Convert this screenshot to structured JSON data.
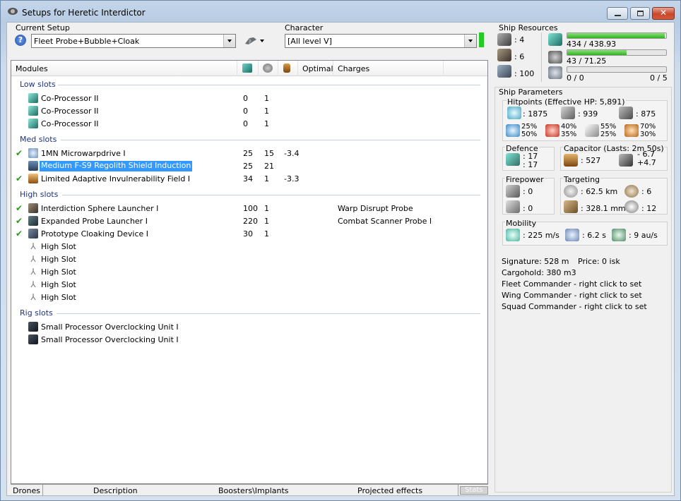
{
  "window": {
    "title": "Setups for Heretic Interdictor",
    "buttons": {
      "minimize": "minimize-icon",
      "maximize": "maximize-icon",
      "close": "close-icon"
    }
  },
  "setup": {
    "label": "Current Setup",
    "value": "Fleet Probe+Bubble+Cloak"
  },
  "character": {
    "label": "Character",
    "value": "[All level V]",
    "status_color": "#22cc22"
  },
  "columns": [
    "Modules",
    "",
    "",
    "",
    "Optimal",
    "Charges"
  ],
  "groups": {
    "low": "Low slots",
    "med": "Med slots",
    "high": "High slots",
    "rig": "Rig slots"
  },
  "modules": {
    "low": [
      {
        "name": "Co-Processor II",
        "cpu": "0",
        "pg": "1",
        "cap": "",
        "charge": ""
      },
      {
        "name": "Co-Processor II",
        "cpu": "0",
        "pg": "1",
        "cap": "",
        "charge": ""
      },
      {
        "name": "Co-Processor II",
        "cpu": "0",
        "pg": "1",
        "cap": "",
        "charge": ""
      }
    ],
    "med": [
      {
        "name": "1MN Microwarpdrive I",
        "cpu": "25",
        "pg": "15",
        "cap": "-3.4",
        "charge": ""
      },
      {
        "name": "Medium F-S9 Regolith Shield Induction",
        "cpu": "25",
        "pg": "21",
        "cap": "",
        "charge": ""
      },
      {
        "name": "Limited Adaptive Invulnerability Field I",
        "cpu": "34",
        "pg": "1",
        "cap": "-3.3",
        "charge": ""
      }
    ],
    "high": [
      {
        "name": "Interdiction Sphere Launcher I",
        "cpu": "100",
        "pg": "1",
        "cap": "",
        "charge": "Warp Disrupt Probe"
      },
      {
        "name": "Expanded Probe Launcher I",
        "cpu": "220",
        "pg": "1",
        "cap": "",
        "charge": "Combat Scanner Probe I"
      },
      {
        "name": "Prototype Cloaking Device I",
        "cpu": "30",
        "pg": "1",
        "cap": "",
        "charge": ""
      },
      {
        "name": "High Slot",
        "cpu": "",
        "pg": "",
        "cap": "",
        "charge": ""
      },
      {
        "name": "High Slot",
        "cpu": "",
        "pg": "",
        "cap": "",
        "charge": ""
      },
      {
        "name": "High Slot",
        "cpu": "",
        "pg": "",
        "cap": "",
        "charge": ""
      },
      {
        "name": "High Slot",
        "cpu": "",
        "pg": "",
        "cap": "",
        "charge": ""
      },
      {
        "name": "High Slot",
        "cpu": "",
        "pg": "",
        "cap": "",
        "charge": ""
      }
    ],
    "rig": [
      {
        "name": "Small Processor Overclocking Unit I",
        "cpu": "",
        "pg": "",
        "cap": "",
        "charge": ""
      },
      {
        "name": "Small Processor Overclocking Unit I",
        "cpu": "",
        "pg": "",
        "cap": "",
        "charge": ""
      }
    ]
  },
  "tabs": [
    "Drones",
    "Description",
    "Boosters\\Implants",
    "Projected effects",
    "Stats"
  ],
  "resources": {
    "label": "Ship Resources",
    "hardpoints": {
      "turret": ": 4",
      "launcher": ": 6",
      "calibration": ": 100"
    },
    "cpu": {
      "text": "434 / 438.93",
      "fraction": 0.989
    },
    "powergrid": {
      "text": "43 / 71.25",
      "fraction": 0.603
    },
    "drones": {
      "left": "0 / 0",
      "right": "0 / 5",
      "fraction": 0
    }
  },
  "params": {
    "label": "Ship Parameters",
    "hitpoints_label": "Hitpoints (Effective HP: 5,891)",
    "shield_hp": ": 1875",
    "armor_hp": ": 939",
    "structure_hp": ": 875",
    "resists": {
      "em": [
        "25%",
        "50%"
      ],
      "thermal": [
        "40%",
        "35%"
      ],
      "kinetic": [
        "55%",
        "25%"
      ],
      "explosive": [
        "70%",
        "30%"
      ]
    },
    "defence": {
      "label": "Defence",
      "a": ": 17",
      "b": ": 17"
    },
    "capacitor": {
      "label": "Capacitor (Lasts: 2m 50s)",
      "amount": ": 527",
      "delta1": "- 6.7",
      "delta2": "+4.7"
    },
    "firepower": {
      "label": "Firepower",
      "a": ": 0",
      "b": ": 0"
    },
    "targeting": {
      "label": "Targeting",
      "range": ": 62.5 km",
      "max_targets": ": 6",
      "resolution": ": 328.1 mm",
      "sensor": ": 12"
    },
    "mobility": {
      "label": "Mobility",
      "speed": ": 225 m/s",
      "align": ": 6.2 s",
      "warp": ": 9 au/s"
    },
    "signature": "Signature: 528 m",
    "price": "Price: 0 isk",
    "cargo": "Cargohold: 380 m3",
    "fleet": "Fleet Commander - right click to set",
    "wing": "Wing Commander - right click to set",
    "squad": "Squad Commander - right click to set"
  }
}
